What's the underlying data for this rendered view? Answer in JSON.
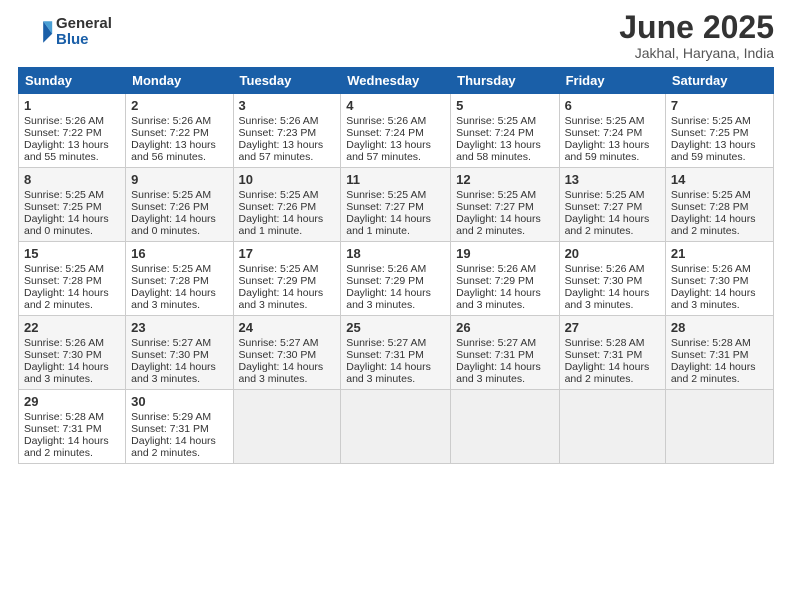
{
  "header": {
    "logo_general": "General",
    "logo_blue": "Blue",
    "month_title": "June 2025",
    "location": "Jakhal, Haryana, India"
  },
  "days_of_week": [
    "Sunday",
    "Monday",
    "Tuesday",
    "Wednesday",
    "Thursday",
    "Friday",
    "Saturday"
  ],
  "weeks": [
    [
      {
        "day": 1,
        "sunrise": "Sunrise: 5:26 AM",
        "sunset": "Sunset: 7:22 PM",
        "daylight": "Daylight: 13 hours and 55 minutes."
      },
      {
        "day": 2,
        "sunrise": "Sunrise: 5:26 AM",
        "sunset": "Sunset: 7:22 PM",
        "daylight": "Daylight: 13 hours and 56 minutes."
      },
      {
        "day": 3,
        "sunrise": "Sunrise: 5:26 AM",
        "sunset": "Sunset: 7:23 PM",
        "daylight": "Daylight: 13 hours and 57 minutes."
      },
      {
        "day": 4,
        "sunrise": "Sunrise: 5:26 AM",
        "sunset": "Sunset: 7:24 PM",
        "daylight": "Daylight: 13 hours and 57 minutes."
      },
      {
        "day": 5,
        "sunrise": "Sunrise: 5:25 AM",
        "sunset": "Sunset: 7:24 PM",
        "daylight": "Daylight: 13 hours and 58 minutes."
      },
      {
        "day": 6,
        "sunrise": "Sunrise: 5:25 AM",
        "sunset": "Sunset: 7:24 PM",
        "daylight": "Daylight: 13 hours and 59 minutes."
      },
      {
        "day": 7,
        "sunrise": "Sunrise: 5:25 AM",
        "sunset": "Sunset: 7:25 PM",
        "daylight": "Daylight: 13 hours and 59 minutes."
      }
    ],
    [
      {
        "day": 8,
        "sunrise": "Sunrise: 5:25 AM",
        "sunset": "Sunset: 7:25 PM",
        "daylight": "Daylight: 14 hours and 0 minutes."
      },
      {
        "day": 9,
        "sunrise": "Sunrise: 5:25 AM",
        "sunset": "Sunset: 7:26 PM",
        "daylight": "Daylight: 14 hours and 0 minutes."
      },
      {
        "day": 10,
        "sunrise": "Sunrise: 5:25 AM",
        "sunset": "Sunset: 7:26 PM",
        "daylight": "Daylight: 14 hours and 1 minute."
      },
      {
        "day": 11,
        "sunrise": "Sunrise: 5:25 AM",
        "sunset": "Sunset: 7:27 PM",
        "daylight": "Daylight: 14 hours and 1 minute."
      },
      {
        "day": 12,
        "sunrise": "Sunrise: 5:25 AM",
        "sunset": "Sunset: 7:27 PM",
        "daylight": "Daylight: 14 hours and 2 minutes."
      },
      {
        "day": 13,
        "sunrise": "Sunrise: 5:25 AM",
        "sunset": "Sunset: 7:27 PM",
        "daylight": "Daylight: 14 hours and 2 minutes."
      },
      {
        "day": 14,
        "sunrise": "Sunrise: 5:25 AM",
        "sunset": "Sunset: 7:28 PM",
        "daylight": "Daylight: 14 hours and 2 minutes."
      }
    ],
    [
      {
        "day": 15,
        "sunrise": "Sunrise: 5:25 AM",
        "sunset": "Sunset: 7:28 PM",
        "daylight": "Daylight: 14 hours and 2 minutes."
      },
      {
        "day": 16,
        "sunrise": "Sunrise: 5:25 AM",
        "sunset": "Sunset: 7:28 PM",
        "daylight": "Daylight: 14 hours and 3 minutes."
      },
      {
        "day": 17,
        "sunrise": "Sunrise: 5:25 AM",
        "sunset": "Sunset: 7:29 PM",
        "daylight": "Daylight: 14 hours and 3 minutes."
      },
      {
        "day": 18,
        "sunrise": "Sunrise: 5:26 AM",
        "sunset": "Sunset: 7:29 PM",
        "daylight": "Daylight: 14 hours and 3 minutes."
      },
      {
        "day": 19,
        "sunrise": "Sunrise: 5:26 AM",
        "sunset": "Sunset: 7:29 PM",
        "daylight": "Daylight: 14 hours and 3 minutes."
      },
      {
        "day": 20,
        "sunrise": "Sunrise: 5:26 AM",
        "sunset": "Sunset: 7:30 PM",
        "daylight": "Daylight: 14 hours and 3 minutes."
      },
      {
        "day": 21,
        "sunrise": "Sunrise: 5:26 AM",
        "sunset": "Sunset: 7:30 PM",
        "daylight": "Daylight: 14 hours and 3 minutes."
      }
    ],
    [
      {
        "day": 22,
        "sunrise": "Sunrise: 5:26 AM",
        "sunset": "Sunset: 7:30 PM",
        "daylight": "Daylight: 14 hours and 3 minutes."
      },
      {
        "day": 23,
        "sunrise": "Sunrise: 5:27 AM",
        "sunset": "Sunset: 7:30 PM",
        "daylight": "Daylight: 14 hours and 3 minutes."
      },
      {
        "day": 24,
        "sunrise": "Sunrise: 5:27 AM",
        "sunset": "Sunset: 7:30 PM",
        "daylight": "Daylight: 14 hours and 3 minutes."
      },
      {
        "day": 25,
        "sunrise": "Sunrise: 5:27 AM",
        "sunset": "Sunset: 7:31 PM",
        "daylight": "Daylight: 14 hours and 3 minutes."
      },
      {
        "day": 26,
        "sunrise": "Sunrise: 5:27 AM",
        "sunset": "Sunset: 7:31 PM",
        "daylight": "Daylight: 14 hours and 3 minutes."
      },
      {
        "day": 27,
        "sunrise": "Sunrise: 5:28 AM",
        "sunset": "Sunset: 7:31 PM",
        "daylight": "Daylight: 14 hours and 2 minutes."
      },
      {
        "day": 28,
        "sunrise": "Sunrise: 5:28 AM",
        "sunset": "Sunset: 7:31 PM",
        "daylight": "Daylight: 14 hours and 2 minutes."
      }
    ],
    [
      {
        "day": 29,
        "sunrise": "Sunrise: 5:28 AM",
        "sunset": "Sunset: 7:31 PM",
        "daylight": "Daylight: 14 hours and 2 minutes."
      },
      {
        "day": 30,
        "sunrise": "Sunrise: 5:29 AM",
        "sunset": "Sunset: 7:31 PM",
        "daylight": "Daylight: 14 hours and 2 minutes."
      },
      null,
      null,
      null,
      null,
      null
    ]
  ]
}
